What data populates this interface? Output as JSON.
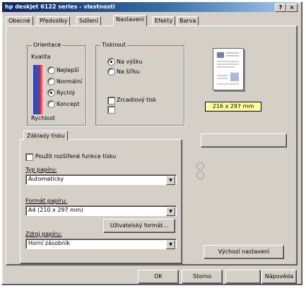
{
  "window": {
    "title": "hp deskjet 6122 series - vlastnosti",
    "controls": [
      "?",
      "×"
    ]
  },
  "tabs": [
    {
      "label": "Obecné"
    },
    {
      "label": "Předvolby"
    },
    {
      "label": "Sdílení"
    },
    {
      "label": "Nastavení"
    },
    {
      "label": "Efekty"
    },
    {
      "label": "Barva"
    }
  ],
  "orientation": {
    "legend": "Orientace",
    "sub": "Kvalita",
    "options": [
      "Nejlepší",
      "Normální",
      "Rychlý",
      "Koncept"
    ],
    "footer": "Rychlost",
    "selected_index": 2
  },
  "print_mode": {
    "legend": "Tisknout",
    "options": [
      "Na výšku",
      "Na šířku"
    ],
    "selected_index": 0,
    "checks": [
      "Zrcadlový tisk",
      ""
    ]
  },
  "preview": {
    "size_label": "216 x 297 mm"
  },
  "subtab": {
    "label": "Základy tisku"
  },
  "subpanel": {
    "check_label": "Použít rozšířené funkce tisku",
    "combo1": {
      "label": "Typ papíru:",
      "value": "Automaticky"
    },
    "combo2": {
      "label": "Formát papíru:",
      "value": "A4 (210 x 297 mm)"
    },
    "custom_button": "Uživatelský formát...",
    "combo3": {
      "label": "Zdroj papíru:",
      "value": "Horní zásobník"
    }
  },
  "right_panel": {
    "disabled_button": "",
    "disabled_text": "",
    "radio1": "",
    "radio2": "",
    "default_button": "Výchozí nastavení"
  },
  "footer_buttons": {
    "ok": "OK",
    "cancel": "Storno",
    "apply": "",
    "help": "Nápověda"
  }
}
